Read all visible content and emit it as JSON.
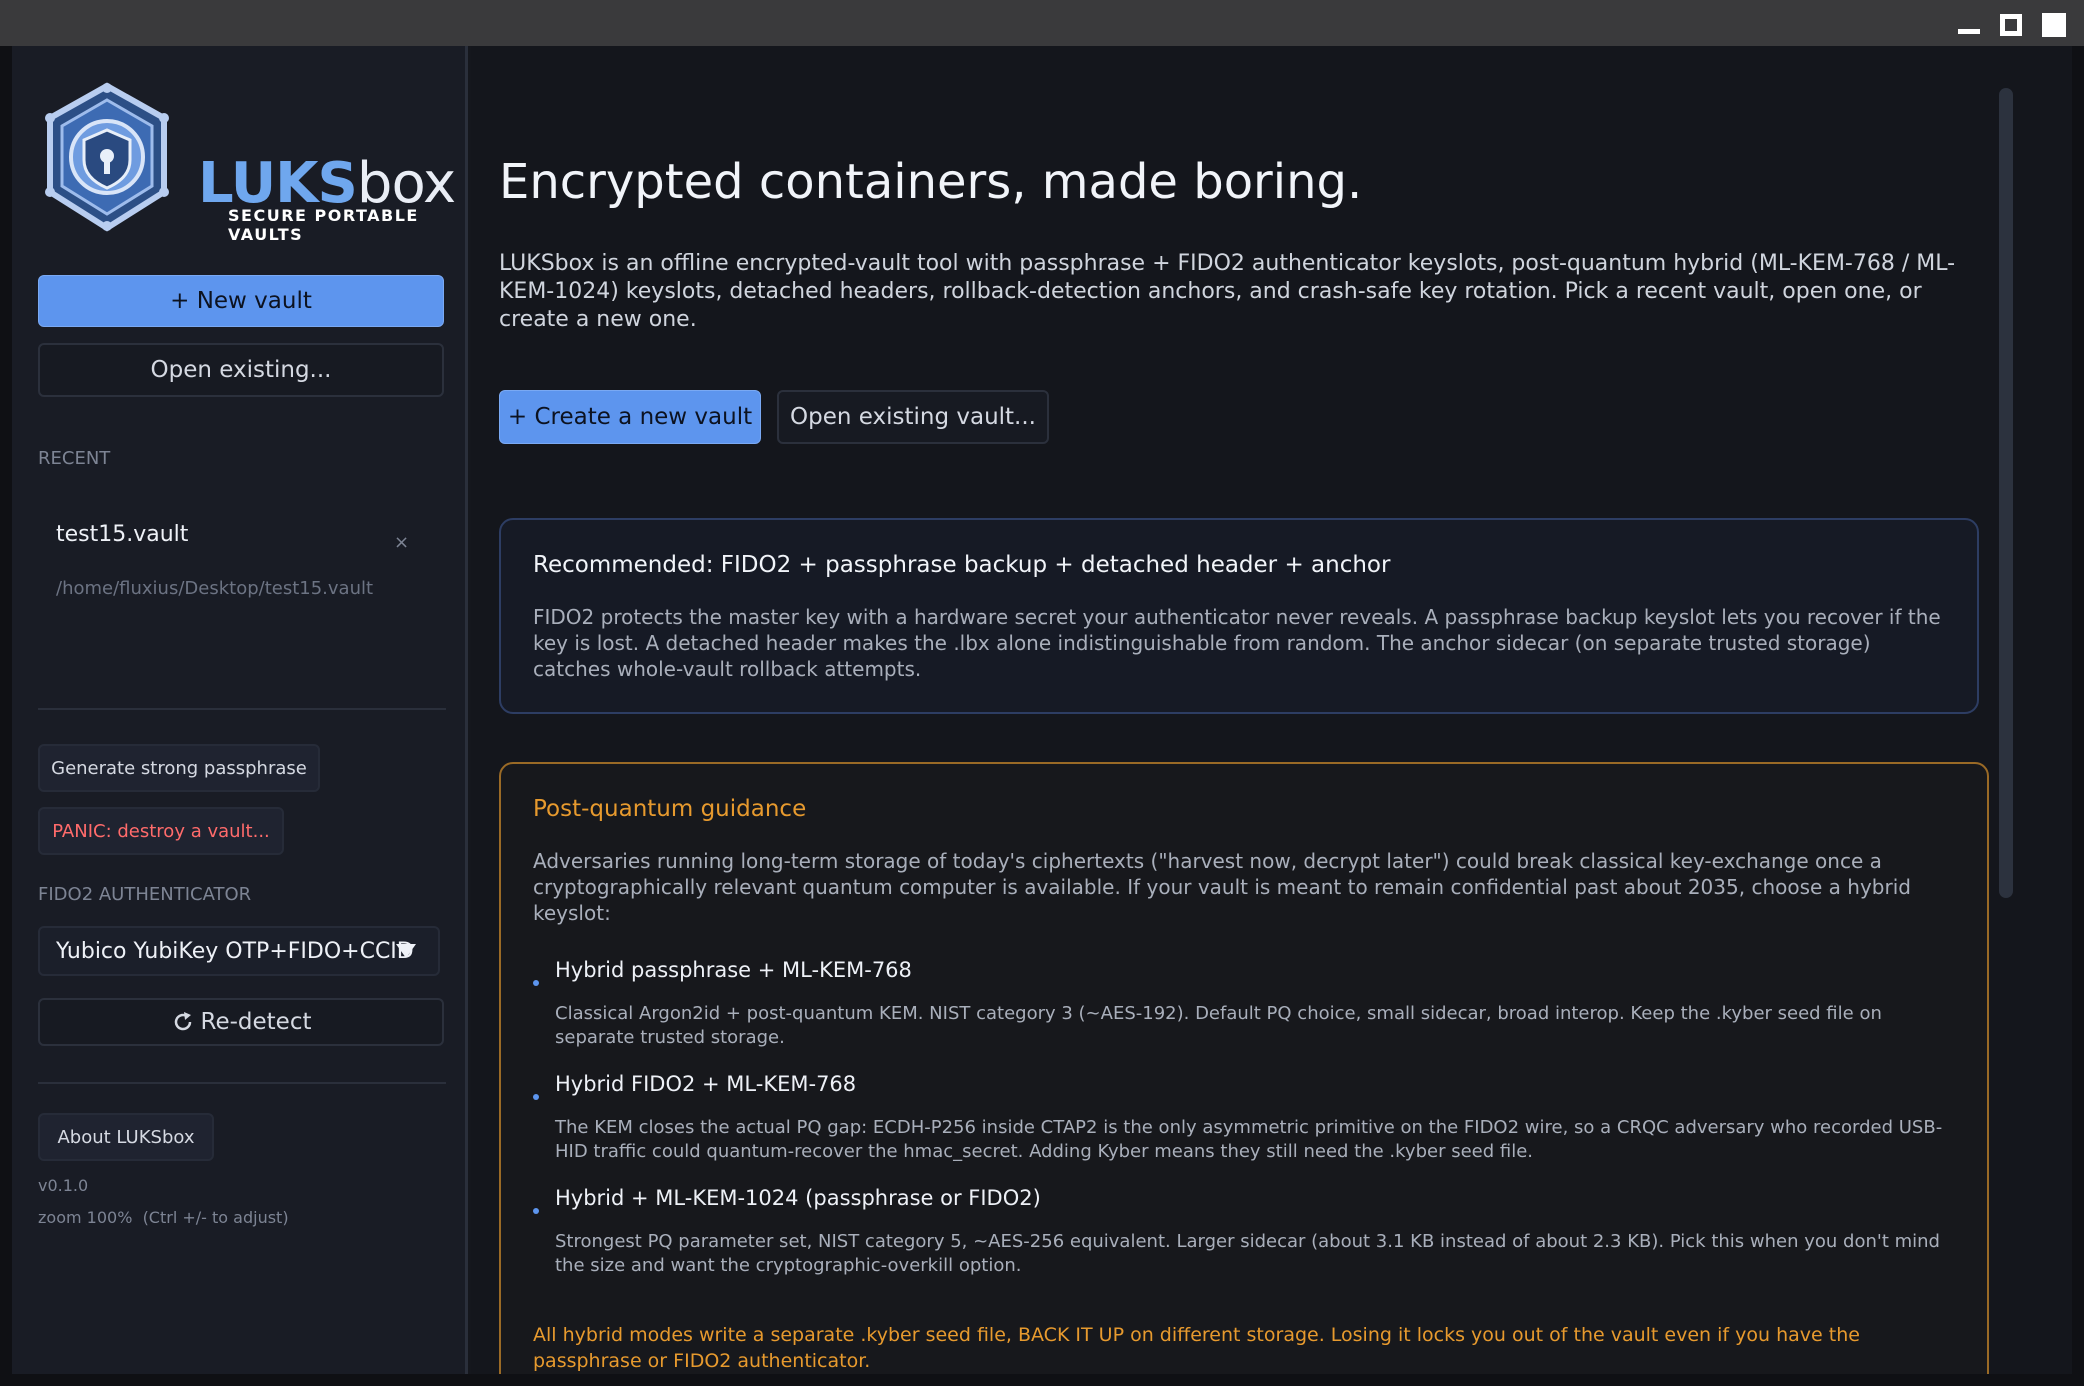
{
  "window_controls": {
    "minimize": "minimize",
    "maximize": "maximize",
    "fullscreen": "fullscreen"
  },
  "brand": {
    "name_bold": "LUKS",
    "name_light": "box",
    "tagline": "SECURE PORTABLE VAULTS",
    "icon": "shield-lock-icon"
  },
  "sidebar": {
    "new_vault_label": "+ New vault",
    "open_existing_label": "Open existing...",
    "recent_header": "RECENT",
    "recent": [
      {
        "name": "test15.vault",
        "path": "/home/fluxius/Desktop/test15.vault",
        "remove_glyph": "×"
      }
    ],
    "generate_passphrase_label": "Generate strong passphrase",
    "panic_label": "PANIC: destroy a vault...",
    "fido2_header": "FIDO2 AUTHENTICATOR",
    "fido2_selected": "Yubico YubiKey OTP+FIDO+CCID",
    "redetect_label": "Re-detect",
    "redetect_icon": "refresh-icon",
    "about_label": "About LUKSbox",
    "version": "v0.1.0",
    "zoom": "zoom 100%  (Ctrl +/- to adjust)"
  },
  "main": {
    "title": "Encrypted containers, made boring.",
    "intro": "LUKSbox is an offline encrypted-vault tool with passphrase + FIDO2 authenticator keyslots, post-quantum hybrid (ML-KEM-768 / ML-KEM-1024) keyslots, detached headers, rollback-detection anchors, and crash-safe key rotation. Pick a recent vault, open one, or create a new one.",
    "create_label": "+ Create a new vault",
    "open_label": "Open existing vault...",
    "recommended": {
      "title": "Recommended: FIDO2 + passphrase backup + detached header + anchor",
      "body": "FIDO2 protects the master key with a hardware secret your authenticator never reveals. A passphrase backup keyslot lets you recover if the key is lost. A detached header makes the .lbx alone indistinguishable from random. The anchor sidecar (on separate trusted storage) catches whole-vault rollback attempts."
    },
    "pq": {
      "title": "Post-quantum guidance",
      "body": "Adversaries running long-term storage of today's ciphertexts (\"harvest now, decrypt later\") could break classical key-exchange once a cryptographically relevant quantum computer is available. If your vault is meant to remain confidential past about 2035, choose a hybrid keyslot:",
      "items": [
        {
          "title": "Hybrid passphrase + ML-KEM-768",
          "body": "Classical Argon2id + post-quantum KEM. NIST category 3 (~AES-192). Default PQ choice, small sidecar, broad interop. Keep the .kyber seed file on separate trusted storage."
        },
        {
          "title": "Hybrid FIDO2 + ML-KEM-768",
          "body": "The KEM closes the actual PQ gap: ECDH-P256 inside CTAP2 is the only asymmetric primitive on the FIDO2 wire, so a CRQC adversary who recorded USB-HID traffic could quantum-recover the hmac_secret. Adding Kyber means they still need the .kyber seed file."
        },
        {
          "title": "Hybrid + ML-KEM-1024 (passphrase or FIDO2)",
          "body": "Strongest PQ parameter set, NIST category 5, ~AES-256 equivalent. Larger sidecar (about 3.1 KB instead of about 2.3 KB). Pick this when you don't mind the size and want the cryptographic-overkill option."
        }
      ],
      "warning": "All hybrid modes write a separate .kyber seed file, BACK IT UP on different storage. Losing it locks you out of the vault even if you have the passphrase or FIDO2 authenticator."
    }
  },
  "colors": {
    "accent": "#5d95ee",
    "warning": "#e79a2e",
    "danger": "#ff6b6b"
  }
}
